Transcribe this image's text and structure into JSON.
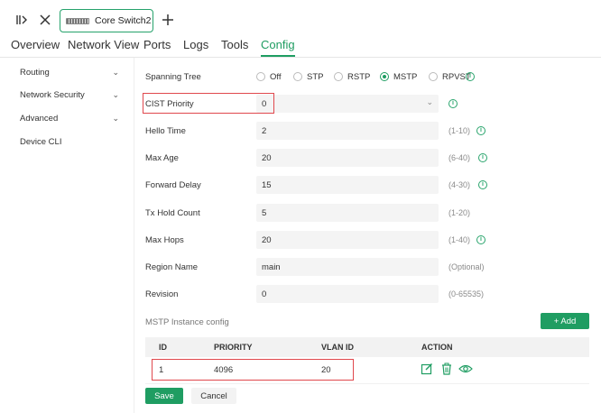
{
  "toolbar": {
    "device_tab_label": "Core Switch2"
  },
  "nav": {
    "tabs": [
      {
        "label": "Overview"
      },
      {
        "label": "Network View"
      },
      {
        "label": "Ports"
      },
      {
        "label": "Logs"
      },
      {
        "label": "Tools"
      },
      {
        "label": "Config"
      }
    ],
    "active_tab": "Config"
  },
  "sidebar": {
    "items": [
      {
        "label": "Routing"
      },
      {
        "label": "Network Security"
      },
      {
        "label": "Advanced"
      },
      {
        "label": "Device CLI"
      }
    ]
  },
  "form": {
    "spanning_tree": {
      "label": "Spanning Tree",
      "options": [
        "Off",
        "STP",
        "RSTP",
        "MSTP",
        "RPVST"
      ],
      "selected": "MSTP"
    },
    "cist_priority": {
      "label": "CIST Priority",
      "value": "0"
    },
    "hello_time": {
      "label": "Hello Time",
      "value": "2",
      "hint": "(1-10)"
    },
    "max_age": {
      "label": "Max Age",
      "value": "20",
      "hint": "(6-40)"
    },
    "forward_delay": {
      "label": "Forward Delay",
      "value": "15",
      "hint": "(4-30)"
    },
    "tx_hold_count": {
      "label": "Tx Hold Count",
      "value": "5",
      "hint": "(1-20)"
    },
    "max_hops": {
      "label": "Max Hops",
      "value": "20",
      "hint": "(1-40)"
    },
    "region_name": {
      "label": "Region Name",
      "value": "main",
      "hint": "(Optional)"
    },
    "revision": {
      "label": "Revision",
      "value": "0",
      "hint": "(0-65535)"
    }
  },
  "mstp": {
    "section_title": "MSTP Instance config",
    "add_label": "+ Add",
    "columns": [
      "ID",
      "PRIORITY",
      "VLAN ID",
      "ACTION"
    ],
    "rows": [
      {
        "id": "1",
        "priority": "4096",
        "vlan_id": "20"
      }
    ]
  },
  "actions": {
    "save_label": "Save",
    "cancel_label": "Cancel"
  },
  "colors": {
    "accent": "#1f9d62",
    "highlight_box": "#e0484d"
  }
}
